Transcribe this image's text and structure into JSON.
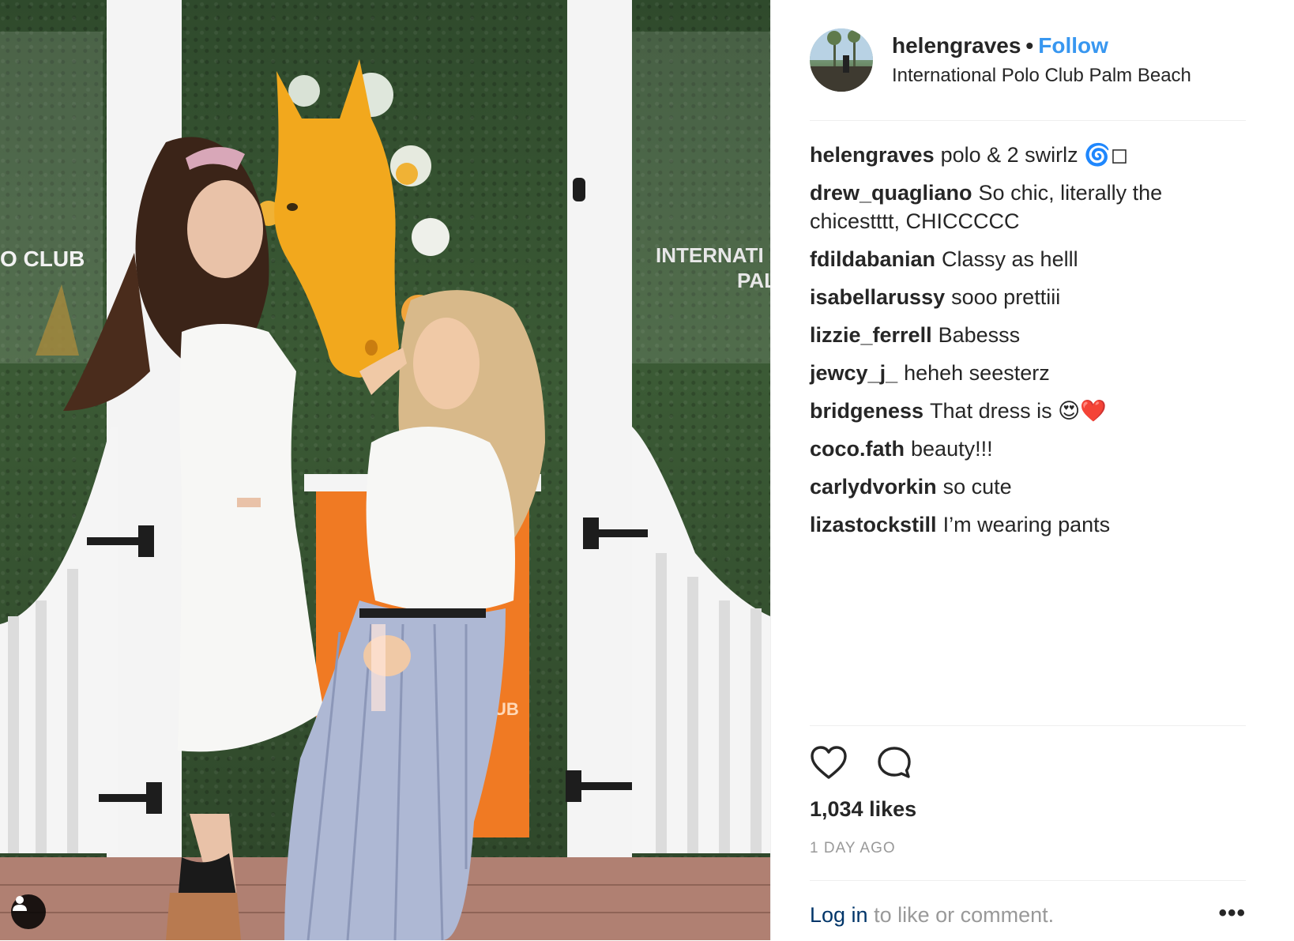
{
  "post": {
    "username": "helengraves",
    "separator": "•",
    "follow_label": "Follow",
    "location": "International Polo Club Palm Beach",
    "caption": {
      "author": "helengraves",
      "text": "polo & 2 swirlz 🌀◻"
    },
    "comments": [
      {
        "author": "drew_quagliano",
        "text": "So chic, literally the chicestttt, CHICCCCC"
      },
      {
        "author": "fdildabanian",
        "text": "Classy as helll"
      },
      {
        "author": "isabellarussy",
        "text": "sooo prettiii"
      },
      {
        "author": "lizzie_ferrell",
        "text": "Babesss"
      },
      {
        "author": "jewcy_j_",
        "text": "heheh seesterz"
      },
      {
        "author": "bridgeness",
        "text": "That dress is 😍❤️"
      },
      {
        "author": "coco.fath",
        "text": "beauty!!!"
      },
      {
        "author": "carlydvorkin",
        "text": "so cute"
      },
      {
        "author": "lizastockstill",
        "text": "I’m wearing pants"
      }
    ],
    "likes": "1,034 likes",
    "timestamp": "1 DAY AGO",
    "login_link": "Log in",
    "login_suffix": " to like or comment.",
    "more_label": "•••"
  },
  "photo_signage": {
    "left_sign": "O CLUB",
    "right_sign_line1": "INTERNATI",
    "right_sign_line2": "PAL",
    "door_sign": "UB"
  },
  "icons": {
    "like": "heart-icon",
    "comment": "comment-bubble-icon",
    "tag": "user-tag-icon"
  },
  "colors": {
    "link_blue": "#3897f0",
    "login_blue": "#003569",
    "text": "#262626",
    "muted": "#999999",
    "horse": "#f2a81d",
    "door_orange": "#f07a23"
  }
}
